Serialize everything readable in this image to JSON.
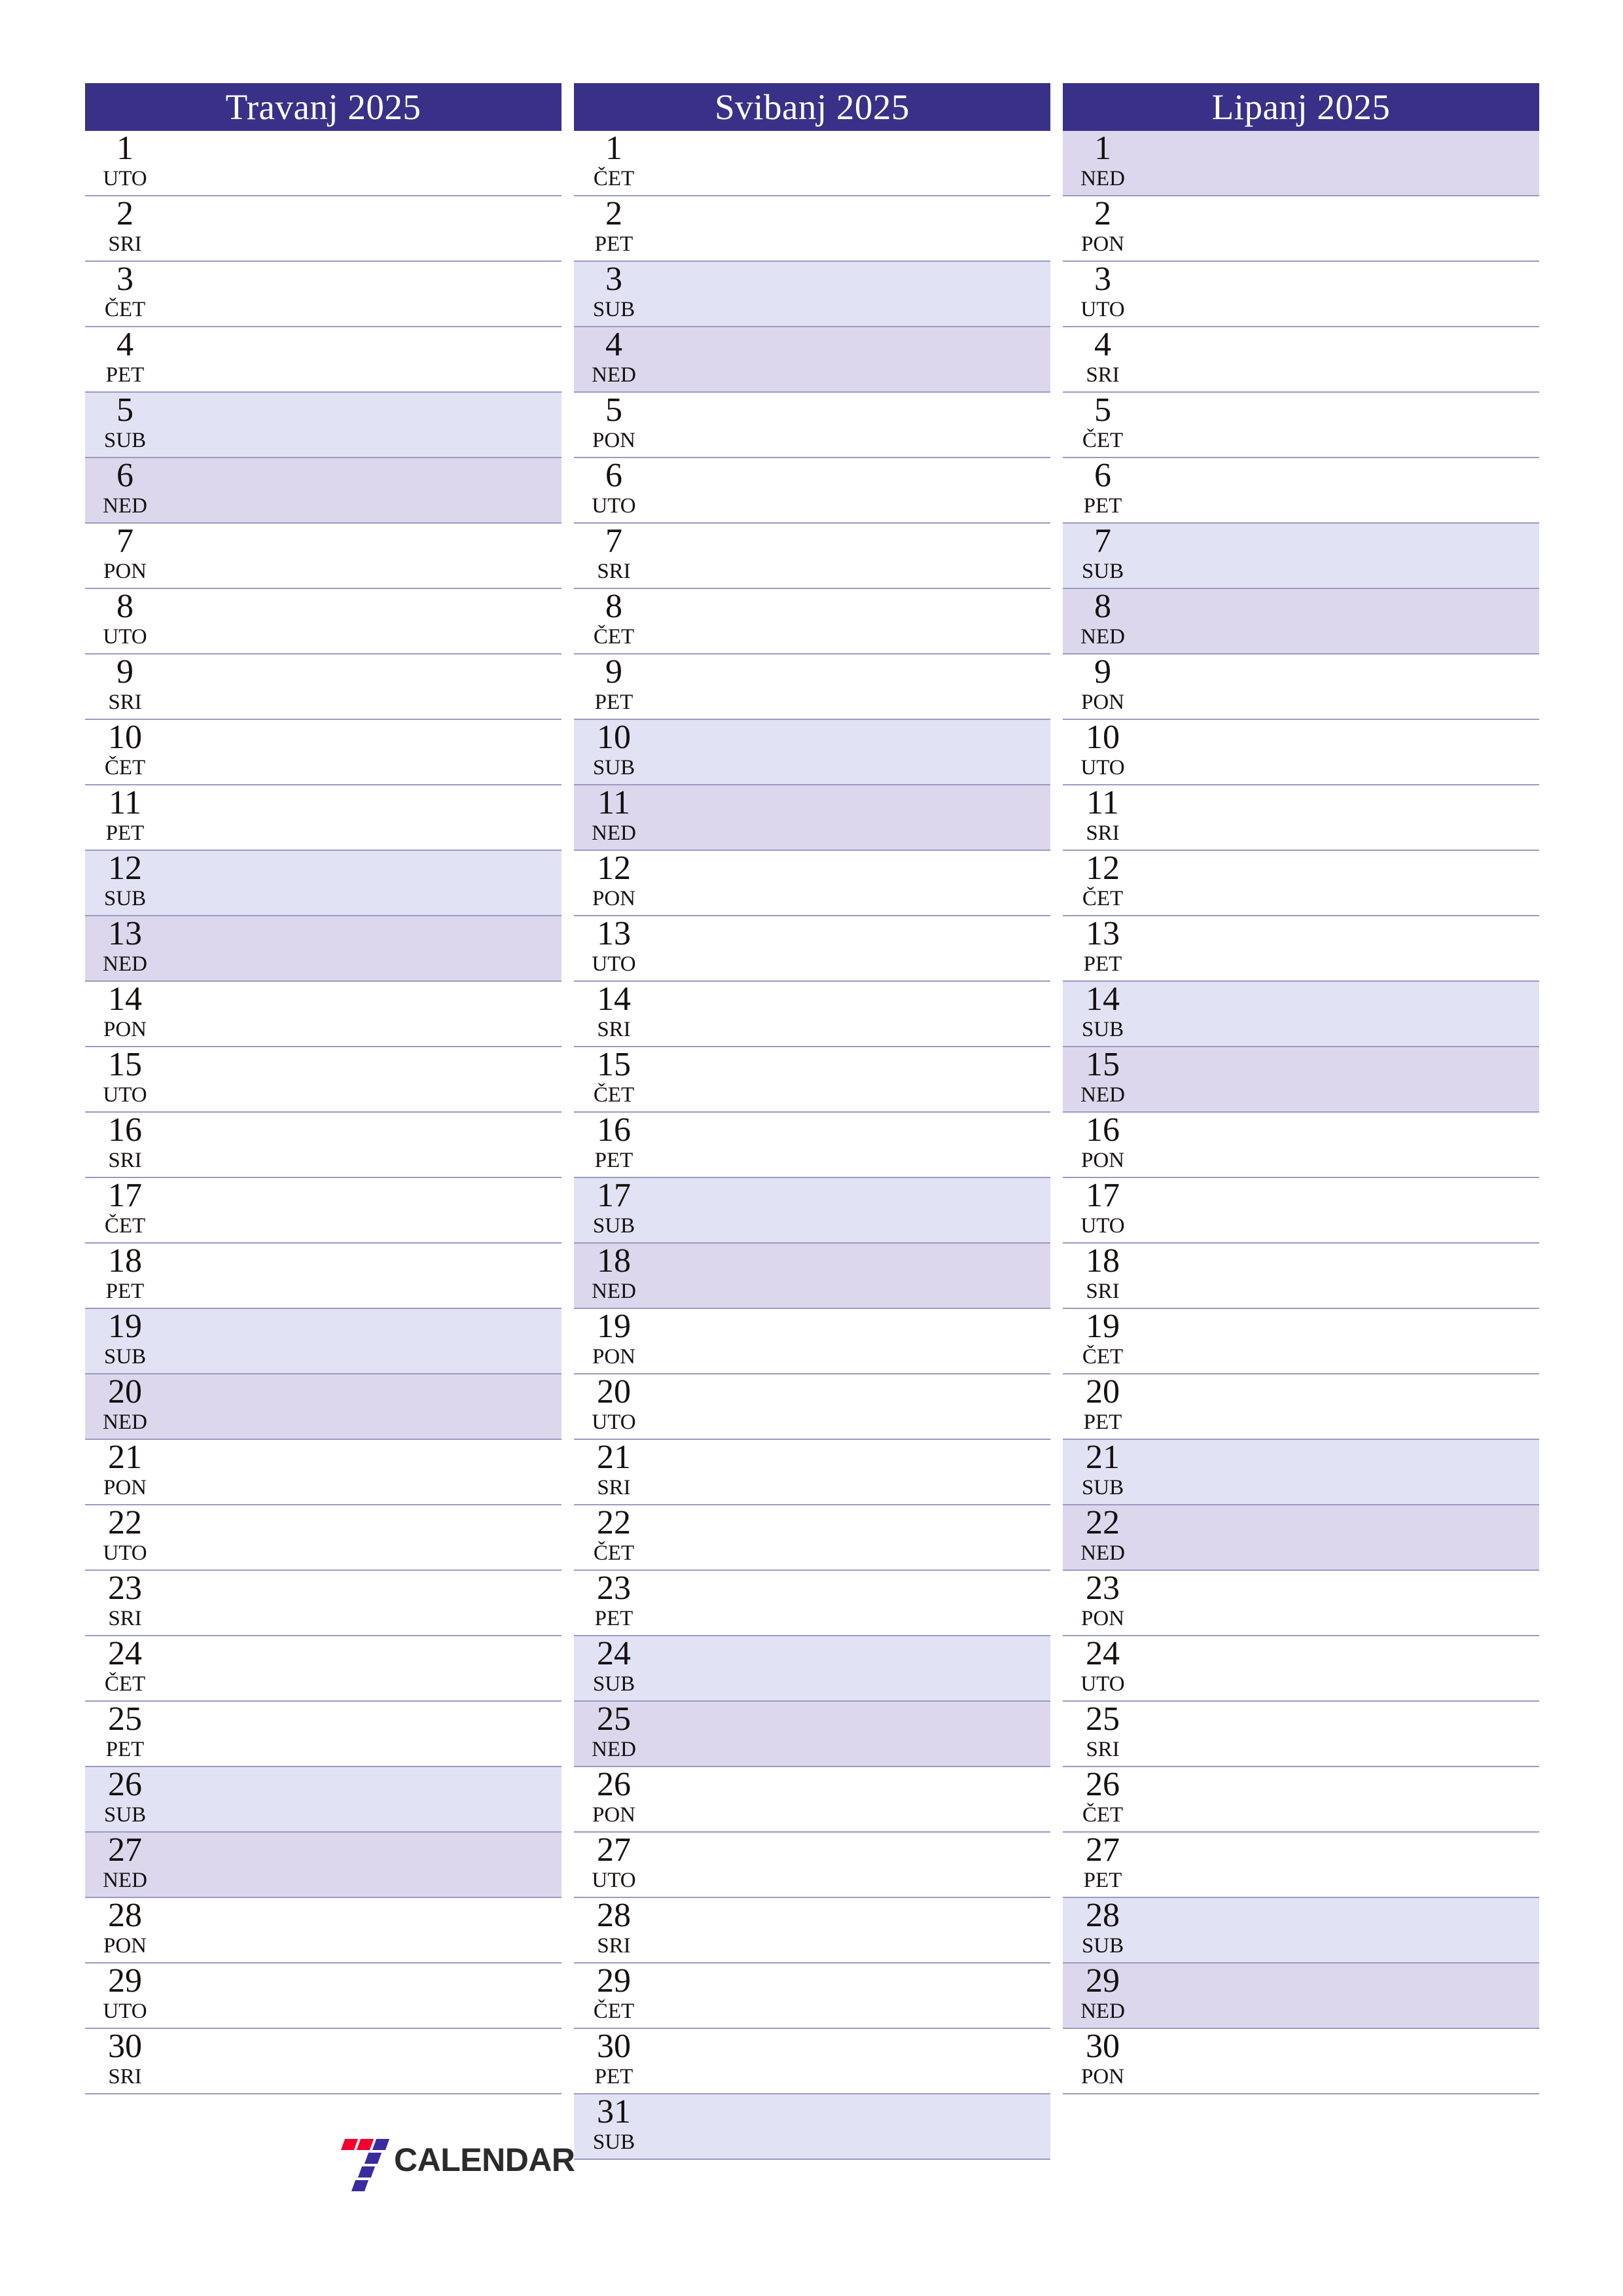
{
  "document": {
    "title": "Travanj 2025 - Lipanj 2025",
    "locale": "hr",
    "page_size": "A4 portrait",
    "colors": {
      "header_background": "#393188",
      "header_text": "#ffffff",
      "saturday_background": "#e2e2f5",
      "sunday_background": "#dcd7ec",
      "row_separator": "#9c9ac2",
      "day_text": "#14100f",
      "page_background": "#ffffff",
      "logo_red": "#f2002e",
      "logo_purple": "#3b2ba0",
      "logo_text": "#2b2b2b"
    }
  },
  "branding": {
    "logo_icon": "seven-logo-icon",
    "name": "CALENDAR"
  },
  "months": [
    {
      "name": "Travanj 2025",
      "days": [
        {
          "num": "1",
          "abbr": "UTO",
          "type": "weekday"
        },
        {
          "num": "2",
          "abbr": "SRI",
          "type": "weekday"
        },
        {
          "num": "3",
          "abbr": "ČET",
          "type": "weekday"
        },
        {
          "num": "4",
          "abbr": "PET",
          "type": "weekday"
        },
        {
          "num": "5",
          "abbr": "SUB",
          "type": "saturday"
        },
        {
          "num": "6",
          "abbr": "NED",
          "type": "sunday"
        },
        {
          "num": "7",
          "abbr": "PON",
          "type": "weekday"
        },
        {
          "num": "8",
          "abbr": "UTO",
          "type": "weekday"
        },
        {
          "num": "9",
          "abbr": "SRI",
          "type": "weekday"
        },
        {
          "num": "10",
          "abbr": "ČET",
          "type": "weekday"
        },
        {
          "num": "11",
          "abbr": "PET",
          "type": "weekday"
        },
        {
          "num": "12",
          "abbr": "SUB",
          "type": "saturday"
        },
        {
          "num": "13",
          "abbr": "NED",
          "type": "sunday"
        },
        {
          "num": "14",
          "abbr": "PON",
          "type": "weekday"
        },
        {
          "num": "15",
          "abbr": "UTO",
          "type": "weekday"
        },
        {
          "num": "16",
          "abbr": "SRI",
          "type": "weekday"
        },
        {
          "num": "17",
          "abbr": "ČET",
          "type": "weekday"
        },
        {
          "num": "18",
          "abbr": "PET",
          "type": "weekday"
        },
        {
          "num": "19",
          "abbr": "SUB",
          "type": "saturday"
        },
        {
          "num": "20",
          "abbr": "NED",
          "type": "sunday"
        },
        {
          "num": "21",
          "abbr": "PON",
          "type": "weekday"
        },
        {
          "num": "22",
          "abbr": "UTO",
          "type": "weekday"
        },
        {
          "num": "23",
          "abbr": "SRI",
          "type": "weekday"
        },
        {
          "num": "24",
          "abbr": "ČET",
          "type": "weekday"
        },
        {
          "num": "25",
          "abbr": "PET",
          "type": "weekday"
        },
        {
          "num": "26",
          "abbr": "SUB",
          "type": "saturday"
        },
        {
          "num": "27",
          "abbr": "NED",
          "type": "sunday"
        },
        {
          "num": "28",
          "abbr": "PON",
          "type": "weekday"
        },
        {
          "num": "29",
          "abbr": "UTO",
          "type": "weekday"
        },
        {
          "num": "30",
          "abbr": "SRI",
          "type": "weekday"
        }
      ]
    },
    {
      "name": "Svibanj 2025",
      "days": [
        {
          "num": "1",
          "abbr": "ČET",
          "type": "weekday"
        },
        {
          "num": "2",
          "abbr": "PET",
          "type": "weekday"
        },
        {
          "num": "3",
          "abbr": "SUB",
          "type": "saturday"
        },
        {
          "num": "4",
          "abbr": "NED",
          "type": "sunday"
        },
        {
          "num": "5",
          "abbr": "PON",
          "type": "weekday"
        },
        {
          "num": "6",
          "abbr": "UTO",
          "type": "weekday"
        },
        {
          "num": "7",
          "abbr": "SRI",
          "type": "weekday"
        },
        {
          "num": "8",
          "abbr": "ČET",
          "type": "weekday"
        },
        {
          "num": "9",
          "abbr": "PET",
          "type": "weekday"
        },
        {
          "num": "10",
          "abbr": "SUB",
          "type": "saturday"
        },
        {
          "num": "11",
          "abbr": "NED",
          "type": "sunday"
        },
        {
          "num": "12",
          "abbr": "PON",
          "type": "weekday"
        },
        {
          "num": "13",
          "abbr": "UTO",
          "type": "weekday"
        },
        {
          "num": "14",
          "abbr": "SRI",
          "type": "weekday"
        },
        {
          "num": "15",
          "abbr": "ČET",
          "type": "weekday"
        },
        {
          "num": "16",
          "abbr": "PET",
          "type": "weekday"
        },
        {
          "num": "17",
          "abbr": "SUB",
          "type": "saturday"
        },
        {
          "num": "18",
          "abbr": "NED",
          "type": "sunday"
        },
        {
          "num": "19",
          "abbr": "PON",
          "type": "weekday"
        },
        {
          "num": "20",
          "abbr": "UTO",
          "type": "weekday"
        },
        {
          "num": "21",
          "abbr": "SRI",
          "type": "weekday"
        },
        {
          "num": "22",
          "abbr": "ČET",
          "type": "weekday"
        },
        {
          "num": "23",
          "abbr": "PET",
          "type": "weekday"
        },
        {
          "num": "24",
          "abbr": "SUB",
          "type": "saturday"
        },
        {
          "num": "25",
          "abbr": "NED",
          "type": "sunday"
        },
        {
          "num": "26",
          "abbr": "PON",
          "type": "weekday"
        },
        {
          "num": "27",
          "abbr": "UTO",
          "type": "weekday"
        },
        {
          "num": "28",
          "abbr": "SRI",
          "type": "weekday"
        },
        {
          "num": "29",
          "abbr": "ČET",
          "type": "weekday"
        },
        {
          "num": "30",
          "abbr": "PET",
          "type": "weekday"
        },
        {
          "num": "31",
          "abbr": "SUB",
          "type": "saturday"
        }
      ]
    },
    {
      "name": "Lipanj 2025",
      "days": [
        {
          "num": "1",
          "abbr": "NED",
          "type": "sunday"
        },
        {
          "num": "2",
          "abbr": "PON",
          "type": "weekday"
        },
        {
          "num": "3",
          "abbr": "UTO",
          "type": "weekday"
        },
        {
          "num": "4",
          "abbr": "SRI",
          "type": "weekday"
        },
        {
          "num": "5",
          "abbr": "ČET",
          "type": "weekday"
        },
        {
          "num": "6",
          "abbr": "PET",
          "type": "weekday"
        },
        {
          "num": "7",
          "abbr": "SUB",
          "type": "saturday"
        },
        {
          "num": "8",
          "abbr": "NED",
          "type": "sunday"
        },
        {
          "num": "9",
          "abbr": "PON",
          "type": "weekday"
        },
        {
          "num": "10",
          "abbr": "UTO",
          "type": "weekday"
        },
        {
          "num": "11",
          "abbr": "SRI",
          "type": "weekday"
        },
        {
          "num": "12",
          "abbr": "ČET",
          "type": "weekday"
        },
        {
          "num": "13",
          "abbr": "PET",
          "type": "weekday"
        },
        {
          "num": "14",
          "abbr": "SUB",
          "type": "saturday"
        },
        {
          "num": "15",
          "abbr": "NED",
          "type": "sunday"
        },
        {
          "num": "16",
          "abbr": "PON",
          "type": "weekday"
        },
        {
          "num": "17",
          "abbr": "UTO",
          "type": "weekday"
        },
        {
          "num": "18",
          "abbr": "SRI",
          "type": "weekday"
        },
        {
          "num": "19",
          "abbr": "ČET",
          "type": "weekday"
        },
        {
          "num": "20",
          "abbr": "PET",
          "type": "weekday"
        },
        {
          "num": "21",
          "abbr": "SUB",
          "type": "saturday"
        },
        {
          "num": "22",
          "abbr": "NED",
          "type": "sunday"
        },
        {
          "num": "23",
          "abbr": "PON",
          "type": "weekday"
        },
        {
          "num": "24",
          "abbr": "UTO",
          "type": "weekday"
        },
        {
          "num": "25",
          "abbr": "SRI",
          "type": "weekday"
        },
        {
          "num": "26",
          "abbr": "ČET",
          "type": "weekday"
        },
        {
          "num": "27",
          "abbr": "PET",
          "type": "weekday"
        },
        {
          "num": "28",
          "abbr": "SUB",
          "type": "saturday"
        },
        {
          "num": "29",
          "abbr": "NED",
          "type": "sunday"
        },
        {
          "num": "30",
          "abbr": "PON",
          "type": "weekday"
        }
      ]
    }
  ]
}
